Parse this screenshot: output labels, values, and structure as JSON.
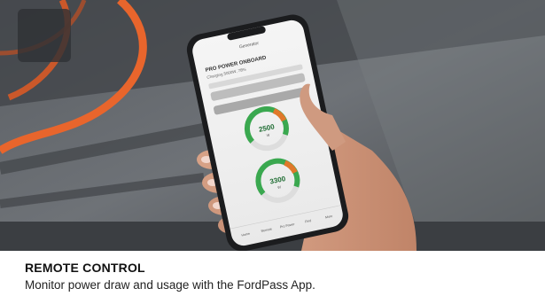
{
  "caption": {
    "title": "REMOTE CONTROL",
    "text": "Monitor power draw and usage with the FordPass App."
  },
  "phone": {
    "header_title": "Generator",
    "panel_title": "PRO POWER ONBOARD",
    "panel_sub": "Charging 5000W, 78%",
    "gauge_top_value": "2500",
    "gauge_top_unit": "W",
    "gauge_bottom_value": "3300",
    "gauge_bottom_unit": "W",
    "nav_items": [
      "Home",
      "Remote",
      "Pro Power",
      "Find",
      "More"
    ]
  },
  "colors": {
    "gauge_green": "#3aa84f",
    "gauge_orange": "#e0782a",
    "cable_orange": "#e8652c",
    "background_blur": "#55585c"
  }
}
